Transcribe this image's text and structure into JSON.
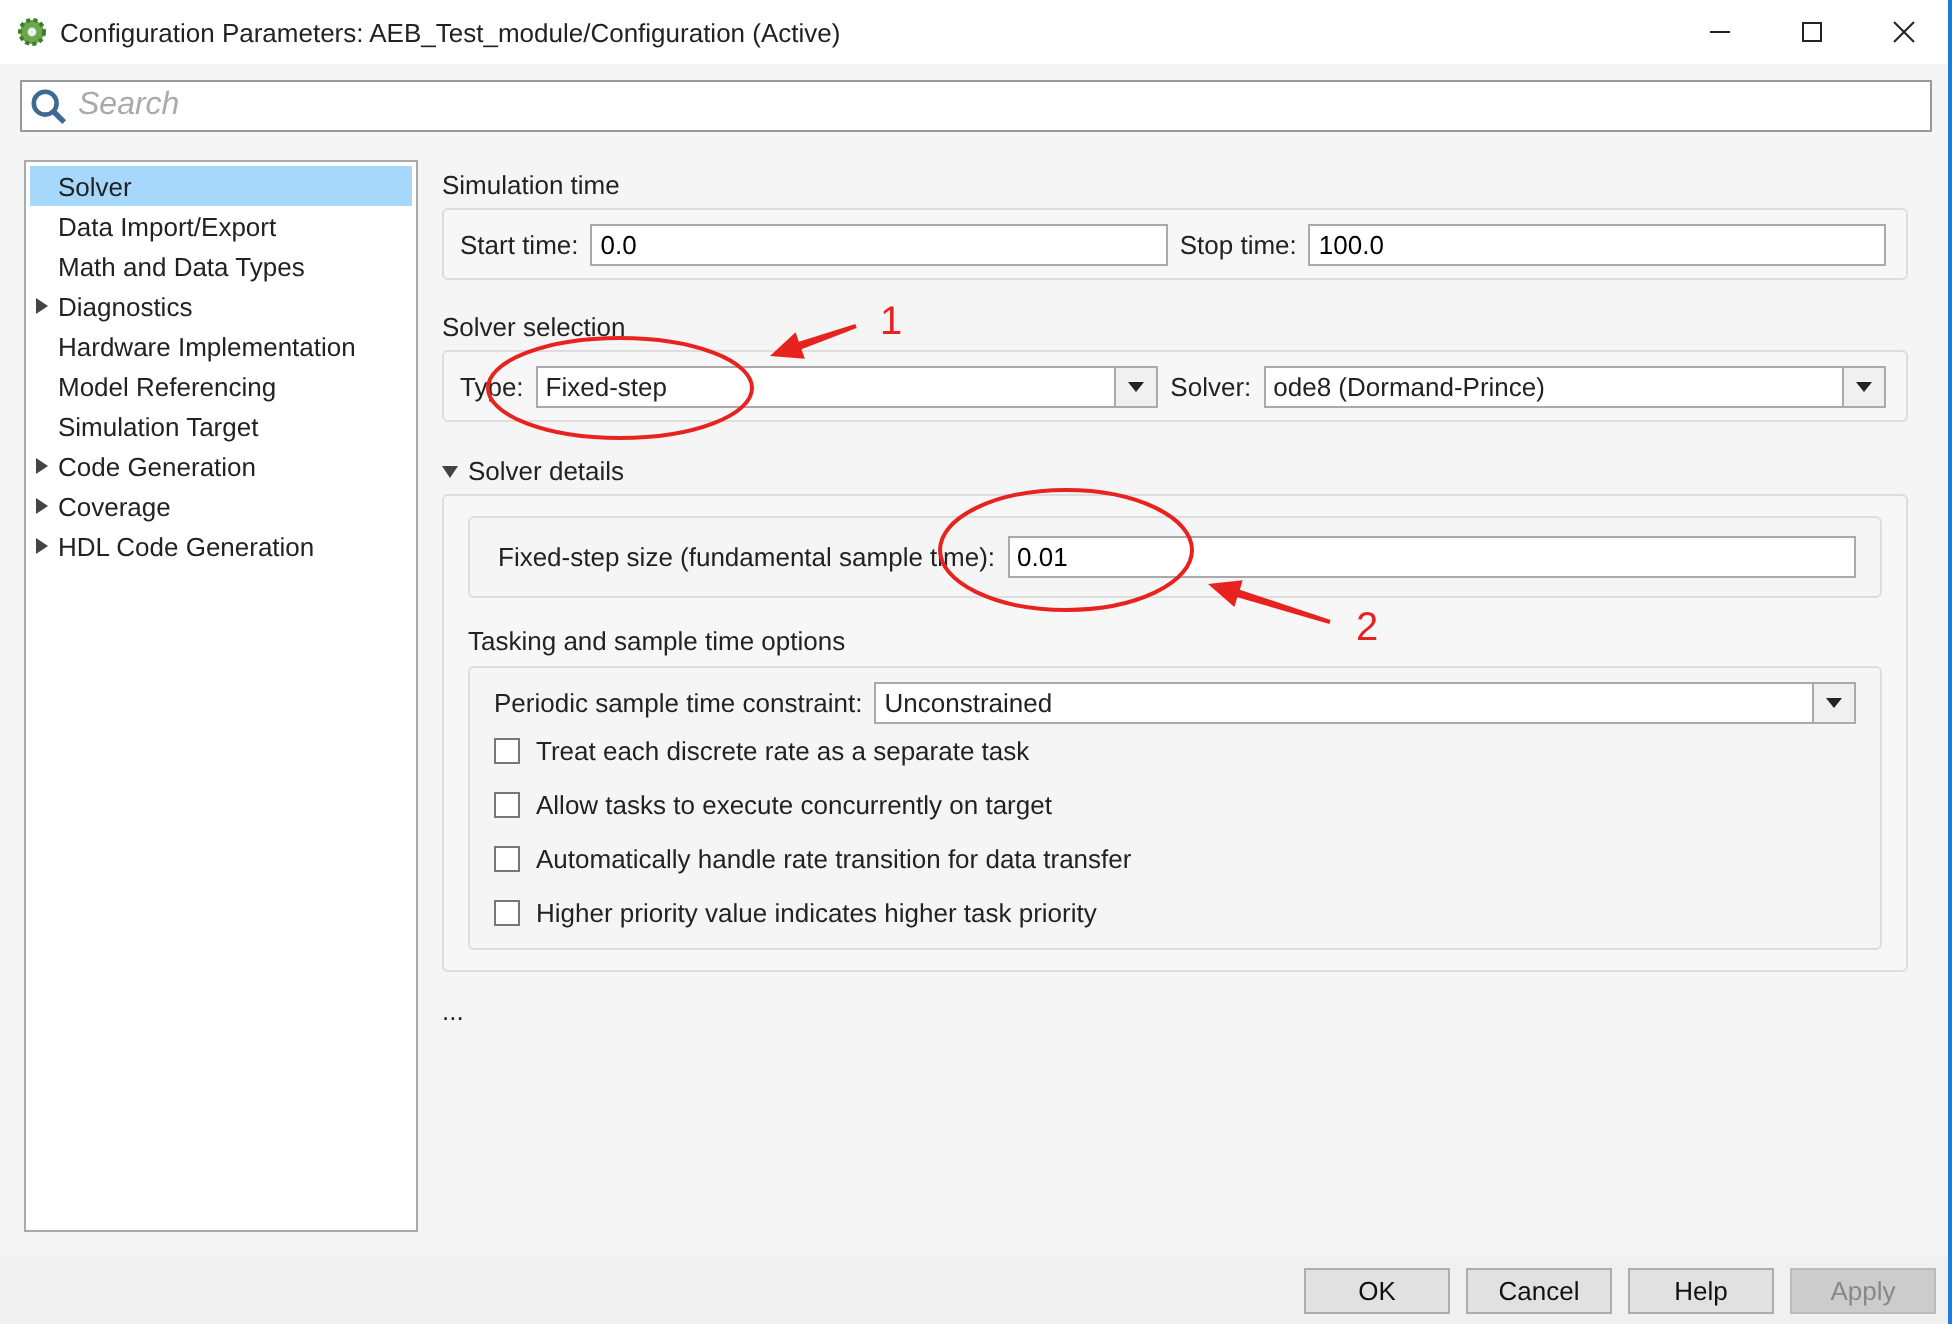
{
  "window": {
    "title": "Configuration Parameters: AEB_Test_module/Configuration (Active)"
  },
  "search": {
    "placeholder": "Search"
  },
  "sidebar": {
    "items": [
      {
        "label": "Solver",
        "kind": "page",
        "selected": true
      },
      {
        "label": "Data Import/Export",
        "kind": "page",
        "selected": false
      },
      {
        "label": "Math and Data Types",
        "kind": "page",
        "selected": false
      },
      {
        "label": "Diagnostics",
        "kind": "group",
        "selected": false
      },
      {
        "label": "Hardware Implementation",
        "kind": "page",
        "selected": false
      },
      {
        "label": "Model Referencing",
        "kind": "page",
        "selected": false
      },
      {
        "label": "Simulation Target",
        "kind": "page",
        "selected": false
      },
      {
        "label": "Code Generation",
        "kind": "group",
        "selected": false
      },
      {
        "label": "Coverage",
        "kind": "group",
        "selected": false
      },
      {
        "label": "HDL Code Generation",
        "kind": "group",
        "selected": false
      }
    ]
  },
  "simulation_time": {
    "title": "Simulation time",
    "start_label": "Start time:",
    "start_value": "0.0",
    "stop_label": "Stop time:",
    "stop_value": "100.0"
  },
  "solver_selection": {
    "title": "Solver selection",
    "type_label": "Type:",
    "type_value": "Fixed-step",
    "solver_label": "Solver:",
    "solver_value": "ode8 (Dormand-Prince)"
  },
  "solver_details": {
    "title": "Solver details",
    "expanded": true,
    "step_label": "Fixed-step size (fundamental sample time):",
    "step_value": "0.01",
    "tasking": {
      "title": "Tasking and sample time options",
      "constraint_label": "Periodic sample time constraint:",
      "constraint_value": "Unconstrained",
      "options": [
        {
          "label": "Treat each discrete rate as a separate task",
          "checked": false
        },
        {
          "label": "Allow tasks to execute concurrently on target",
          "checked": false
        },
        {
          "label": "Automatically handle rate transition for data transfer",
          "checked": false
        },
        {
          "label": "Higher priority value indicates higher task priority",
          "checked": false
        }
      ]
    }
  },
  "more": "...",
  "buttons": [
    {
      "label": "OK",
      "disabled": false
    },
    {
      "label": "Cancel",
      "disabled": false
    },
    {
      "label": "Help",
      "disabled": false
    },
    {
      "label": "Apply",
      "disabled": true
    }
  ],
  "annotations": [
    {
      "label": "1"
    },
    {
      "label": "2"
    }
  ]
}
